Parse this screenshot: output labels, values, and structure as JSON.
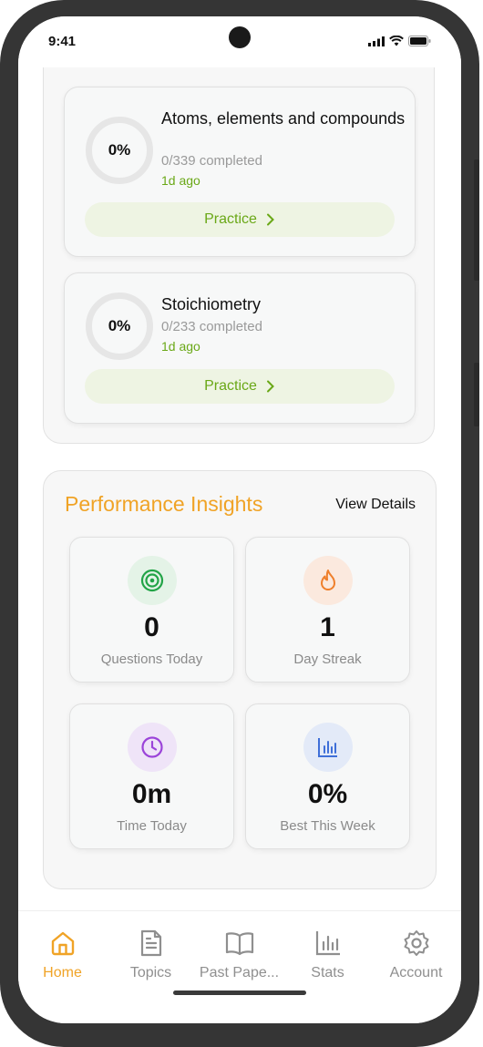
{
  "status_bar": {
    "time": "9:41"
  },
  "topics": [
    {
      "progress": "0%",
      "name": "Atoms, elements and compounds",
      "completed": "0/339 completed",
      "last": "1d ago",
      "action": "Practice"
    },
    {
      "progress": "0%",
      "name": "Stoichiometry",
      "completed": "0/233 completed",
      "last": "1d ago",
      "action": "Practice"
    }
  ],
  "insights": {
    "title": "Performance Insights",
    "view_details": "View Details",
    "stats": [
      {
        "value": "0",
        "label": "Questions Today",
        "icon": "target-icon",
        "color": "#22a447"
      },
      {
        "value": "1",
        "label": "Day Streak",
        "icon": "flame-icon",
        "color": "#ef7f2b"
      },
      {
        "value": "0m",
        "label": "Time Today",
        "icon": "clock-icon",
        "color": "#9b44d9"
      },
      {
        "value": "0%",
        "label": "Best This Week",
        "icon": "bar-chart-icon",
        "color": "#3f6fd8"
      }
    ]
  },
  "tabs": [
    {
      "label": "Home",
      "icon": "home-icon",
      "active": true
    },
    {
      "label": "Topics",
      "icon": "document-icon"
    },
    {
      "label": "Past Pape...",
      "icon": "book-icon"
    },
    {
      "label": "Stats",
      "icon": "stats-icon"
    },
    {
      "label": "Account",
      "icon": "gear-icon"
    }
  ],
  "colors": {
    "accent": "#f0a326",
    "practice_green": "#6aa817"
  }
}
